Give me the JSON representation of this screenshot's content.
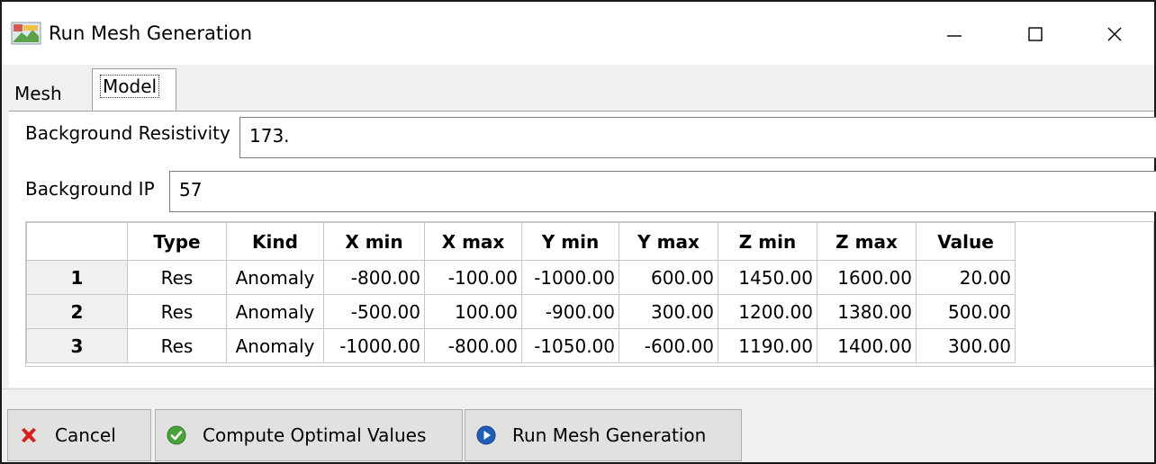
{
  "window": {
    "title": "Run Mesh Generation",
    "controls": {
      "minimize": "—",
      "maximize": "☐",
      "close": "✕"
    }
  },
  "tabs": [
    {
      "label": "Mesh",
      "selected": false
    },
    {
      "label": "Model",
      "selected": true
    }
  ],
  "fields": {
    "background_resistivity": {
      "label": "Background Resistivity",
      "value": "173."
    },
    "background_ip": {
      "label": "Background IP",
      "value": "57"
    }
  },
  "table": {
    "columns": [
      "Type",
      "Kind",
      "X min",
      "X max",
      "Y min",
      "Y max",
      "Z min",
      "Z max",
      "Value"
    ],
    "rows": [
      {
        "index": "1",
        "cells": [
          "Res",
          "Anomaly",
          "-800.00",
          "-100.00",
          "-1000.00",
          "600.00",
          "1450.00",
          "1600.00",
          "20.00"
        ]
      },
      {
        "index": "2",
        "cells": [
          "Res",
          "Anomaly",
          "-500.00",
          "100.00",
          "-900.00",
          "300.00",
          "1200.00",
          "1380.00",
          "500.00"
        ]
      },
      {
        "index": "3",
        "cells": [
          "Res",
          "Anomaly",
          "-1000.00",
          "-800.00",
          "-1050.00",
          "-600.00",
          "1190.00",
          "1400.00",
          "300.00"
        ]
      }
    ]
  },
  "buttons": {
    "cancel": {
      "label": "Cancel",
      "icon": "red-x-icon",
      "color": "#d81e1e"
    },
    "compute": {
      "label": "Compute Optimal Values",
      "icon": "green-check-icon",
      "color": "#4aa33a"
    },
    "run": {
      "label": "Run Mesh Generation",
      "icon": "blue-play-icon",
      "color": "#1f5fb8"
    }
  }
}
